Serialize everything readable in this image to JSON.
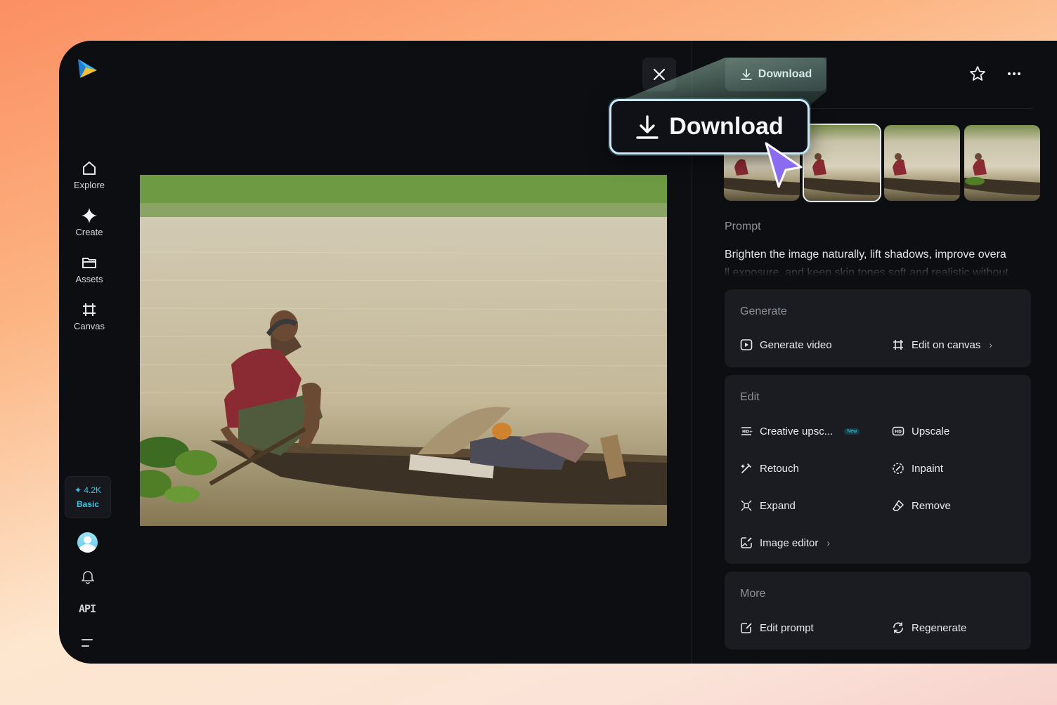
{
  "sidebar": {
    "nav": [
      {
        "label": "Explore",
        "icon": "home-icon"
      },
      {
        "label": "Create",
        "icon": "sparkle-icon"
      },
      {
        "label": "Assets",
        "icon": "folder-icon"
      },
      {
        "label": "Canvas",
        "icon": "frame-icon"
      }
    ],
    "credits": {
      "value": "4.2K",
      "plan": "Basic"
    },
    "api_label": "API"
  },
  "toolbar": {
    "download_label": "Download"
  },
  "callout": {
    "download_label": "Download"
  },
  "prompt": {
    "label": "Prompt",
    "text": "Brighten the image naturally, lift shadows, improve overa",
    "text_line2": "ll exposure, and keep skin tones soft and realistic without"
  },
  "generate": {
    "title": "Generate",
    "items": [
      {
        "label": "Generate video",
        "icon": "play-square-icon"
      },
      {
        "label": "Edit on canvas",
        "icon": "frame-icon",
        "chevron": true
      }
    ]
  },
  "edit": {
    "title": "Edit",
    "new_badge": "New",
    "items": [
      {
        "label": "Creative upsc...",
        "icon": "hd-plus-icon",
        "badge": true
      },
      {
        "label": "Upscale",
        "icon": "hd-icon"
      },
      {
        "label": "Retouch",
        "icon": "magic-wand-icon"
      },
      {
        "label": "Inpaint",
        "icon": "inpaint-icon"
      },
      {
        "label": "Expand",
        "icon": "expand-icon"
      },
      {
        "label": "Remove",
        "icon": "eraser-icon"
      },
      {
        "label": "Image editor",
        "icon": "image-edit-icon",
        "chevron": true
      }
    ]
  },
  "more": {
    "title": "More",
    "items": [
      {
        "label": "Edit prompt",
        "icon": "edit-prompt-icon"
      },
      {
        "label": "Regenerate",
        "icon": "regenerate-icon"
      }
    ]
  },
  "colors": {
    "accent": "#2fc7e6",
    "cursor": "#8b6cf0",
    "panel": "#1a1c21",
    "background": "#0d0e12"
  }
}
